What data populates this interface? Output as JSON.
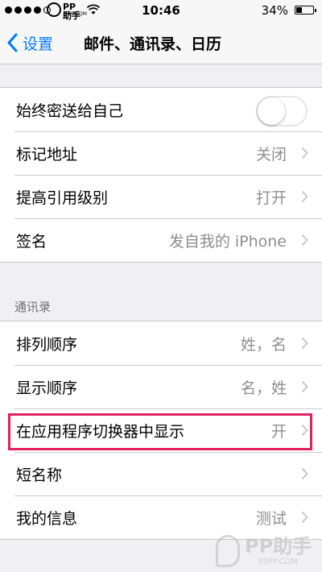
{
  "status_bar": {
    "carrier": "PP助手",
    "carrier_sub": "25PP.COM",
    "time": "10:46",
    "battery_pct": "34%",
    "battery_level": 0.34
  },
  "nav": {
    "back_label": "设置",
    "title": "邮件、通讯录、日历"
  },
  "mail_group": [
    {
      "label": "始终密送给自己",
      "toggle": false
    },
    {
      "label": "标记地址",
      "value": "关闭"
    },
    {
      "label": "提高引用级别",
      "value": "打开"
    },
    {
      "label": "签名",
      "value": "发自我的 iPhone"
    }
  ],
  "contacts_section": {
    "header": "通讯录",
    "items": [
      {
        "label": "排列顺序",
        "value": "姓，名"
      },
      {
        "label": "显示顺序",
        "value": "名，姓"
      },
      {
        "label": "在应用程序切换器中显示",
        "value": "开"
      },
      {
        "label": "短名称",
        "value": ""
      },
      {
        "label": "我的信息",
        "value": "测试"
      }
    ]
  },
  "watermark": {
    "text": "PP助手",
    "sub": "25PP.COM"
  },
  "colors": {
    "accent": "#007aff",
    "highlight": "#e0215b",
    "background": "#efeff4"
  }
}
